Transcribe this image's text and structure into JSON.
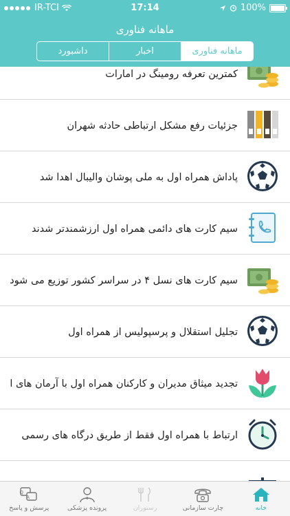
{
  "status_bar": {
    "carrier": "IR-TCI",
    "time": "17:14",
    "battery": "100%"
  },
  "nav": {
    "title": "ماهانه فناوری"
  },
  "segments": [
    {
      "label": "ماهانه فناوری",
      "active": true
    },
    {
      "label": "اخبار",
      "active": false
    },
    {
      "label": "داشبورد",
      "active": false
    }
  ],
  "items": [
    {
      "title": "کمترین تعرفه رومینگ در امارات",
      "icon": "money-coins-icon"
    },
    {
      "title": "جزئیات رفع مشکل ارتباطی حادثه شهران",
      "icon": "binders-icon"
    },
    {
      "title": "پاداش همراه اول به ملی پوشان والیبال اهدا شد",
      "icon": "soccer-ball-icon"
    },
    {
      "title": "سیم کارت های دائمی همراه اول ارزشمندتر شدند",
      "icon": "phonebook-icon"
    },
    {
      "title": "سیم کارت های نسل ۴ در سراسر کشور توزیع می شود",
      "icon": "money-coins-icon"
    },
    {
      "title": "تجلیل استقلال و پرسپولیس از همراه اول",
      "icon": "soccer-ball-icon"
    },
    {
      "title": "تجدید میثاق مدیران و کارکنان همراه اول با آرمان های امام...",
      "icon": "tulip-icon"
    },
    {
      "title": "ارتباط با همراه اول فقط از طریق درگاه های رسمی",
      "icon": "alarm-clock-icon"
    }
  ],
  "tabs": [
    {
      "label": "خانه",
      "icon": "home-icon"
    },
    {
      "label": "چارت سازمانی",
      "icon": "telephone-icon"
    },
    {
      "label": "رستوران",
      "icon": "restaurant-icon"
    },
    {
      "label": "پرونده پزشکی",
      "icon": "doctor-icon"
    },
    {
      "label": "پرسش و پاسخ",
      "icon": "qa-icon"
    }
  ],
  "colors": {
    "accent": "#5cc9c8",
    "tab_active": "#2ab4c0"
  }
}
